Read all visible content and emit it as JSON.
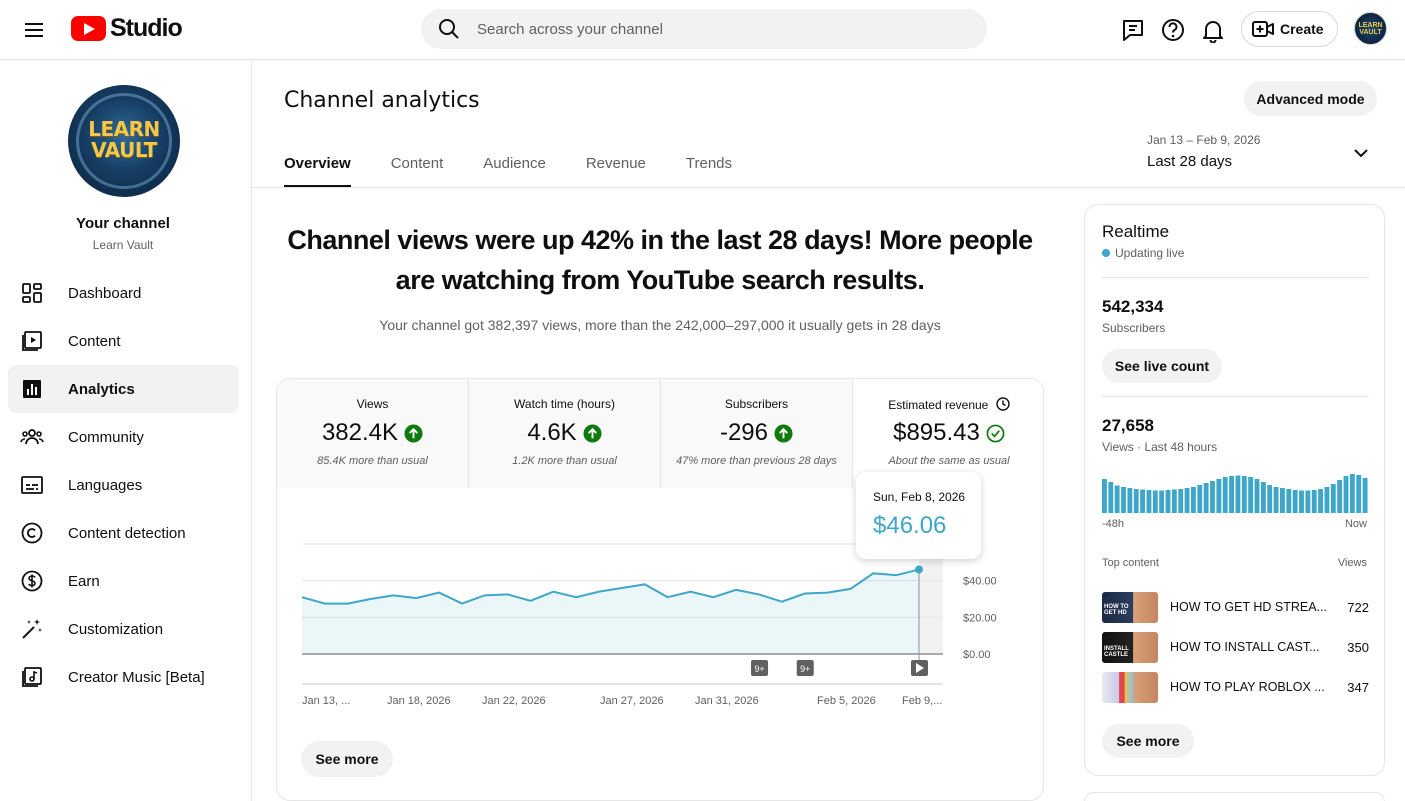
{
  "header": {
    "logo_text": "Studio",
    "search_placeholder": "Search across your channel",
    "create_label": "Create",
    "avatar_text": "LEARN VAULT"
  },
  "sidebar": {
    "channel_label": "Your channel",
    "channel_name": "Learn Vault",
    "avatar_text_line1": "LEARN",
    "avatar_text_line2": "VAULT",
    "items": [
      {
        "label": "Dashboard",
        "icon": "dashboard-icon"
      },
      {
        "label": "Content",
        "icon": "content-icon"
      },
      {
        "label": "Analytics",
        "icon": "analytics-icon",
        "active": true
      },
      {
        "label": "Community",
        "icon": "community-icon"
      },
      {
        "label": "Languages",
        "icon": "languages-icon"
      },
      {
        "label": "Content detection",
        "icon": "copyright-icon"
      },
      {
        "label": "Earn",
        "icon": "earn-icon"
      },
      {
        "label": "Customization",
        "icon": "customization-icon"
      },
      {
        "label": "Creator Music [Beta]",
        "icon": "music-icon"
      }
    ]
  },
  "main": {
    "title": "Channel analytics",
    "advanced_mode_label": "Advanced mode",
    "tabs": [
      "Overview",
      "Content",
      "Audience",
      "Revenue",
      "Trends"
    ],
    "date_range_dates": "Jan 13 – Feb 9, 2026",
    "date_range_label": "Last 28 days",
    "headline_line1": "Channel views were up 42% in the last 28 days! More people",
    "headline_line2": "are watching from YouTube search results.",
    "subheadline": "Your channel got 382,397 views, more than the 242,000–297,000 it usually gets in 28 days",
    "metrics": [
      {
        "label": "Views",
        "value": "382.4K",
        "note": "85.4K more than usual",
        "trend": "up"
      },
      {
        "label": "Watch time (hours)",
        "value": "4.6K",
        "note": "1.2K more than usual",
        "trend": "up"
      },
      {
        "label": "Subscribers",
        "value": "-296",
        "note": "47% more than previous 28 days",
        "trend": "up"
      },
      {
        "label": "Estimated revenue",
        "value": "$895.43",
        "note": "About the same as usual",
        "trend": "check"
      }
    ],
    "tooltip_date": "Sun, Feb 8, 2026",
    "tooltip_value": "$46.06",
    "see_more_label": "See more",
    "markers": [
      "9+",
      "9+"
    ]
  },
  "chart_data": {
    "type": "area",
    "x_tick_labels": [
      "Jan 13, ...",
      "Jan 18, 2026",
      "Jan 22, 2026",
      "Jan 27, 2026",
      "Jan 31, 2026",
      "Feb 5, 2026",
      "Feb 9,..."
    ],
    "y_tick_labels": [
      "$0.00",
      "$20.00",
      "$40.00",
      ".00"
    ],
    "ylim": [
      0,
      60
    ],
    "series": [
      {
        "values": [
          31,
          27.5,
          27.5,
          30,
          32,
          30.5,
          33.5,
          27.5,
          32,
          32.5,
          29,
          34,
          31,
          34,
          36,
          38,
          31,
          34,
          31,
          35,
          32.5,
          28.5,
          33,
          33.5,
          35.5,
          44,
          43,
          46.06
        ]
      }
    ],
    "color": "#3ea6c8"
  },
  "realtime": {
    "title": "Realtime",
    "live_label": "Updating live",
    "subscribers_value": "542,334",
    "subscribers_label": "Subscribers",
    "see_live_count_label": "See live count",
    "views_value": "27,658",
    "views_label": "Views · Last 48 hours",
    "axis_start": "-48h",
    "axis_end": "Now",
    "top_content_label": "Top content",
    "views_col_label": "Views",
    "sparkline": [
      68,
      62,
      55,
      52,
      50,
      48,
      47,
      46,
      45,
      45,
      46,
      47,
      48,
      50,
      52,
      56,
      60,
      64,
      68,
      72,
      74,
      75,
      74,
      72,
      68,
      62,
      56,
      52,
      50,
      48,
      46,
      45,
      45,
      46,
      48,
      52,
      58,
      66,
      74,
      78,
      76,
      70
    ],
    "top_content": [
      {
        "title": "HOW TO GET HD STREA...",
        "views": "722",
        "thumb_text": "HOW TO GET HD"
      },
      {
        "title": "HOW TO INSTALL CAST...",
        "views": "350",
        "thumb_text": "INSTALL CASTLE"
      },
      {
        "title": "HOW TO PLAY ROBLOX ...",
        "views": "347",
        "thumb_text": ""
      }
    ],
    "see_more_label": "See more"
  },
  "colors": {
    "accent": "#3ea6c8",
    "positive": "#0f7b0f",
    "youtube_red": "#ff0000"
  }
}
